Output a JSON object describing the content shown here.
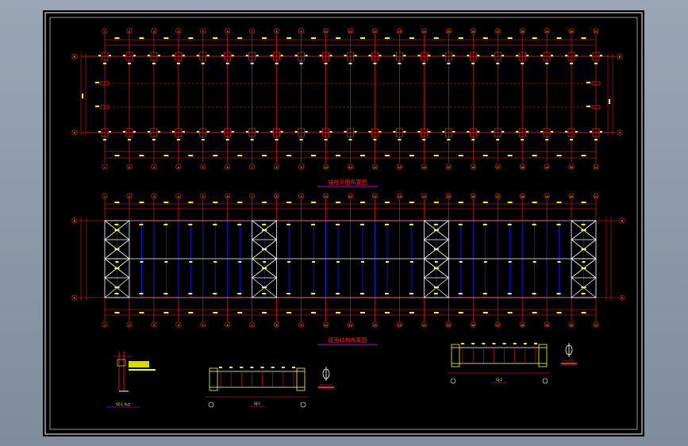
{
  "drawing": {
    "plan_title_1": "锚栓平面布置图",
    "plan_title_2": "屋面结构布置图",
    "row_top": "B",
    "row_bottom": "A",
    "axis_labels": [
      "1",
      "2",
      "3",
      "4",
      "5",
      "6",
      "7",
      "8",
      "9",
      "10",
      "11",
      "12",
      "13",
      "14",
      "15",
      "16",
      "17",
      "18",
      "19",
      "20",
      "21"
    ],
    "detail_labels": [
      "YZ-1 节点",
      "GJ-1",
      "GJ-2"
    ]
  },
  "colors": {
    "background": "#000000",
    "axis_red": "#ff2020",
    "dim_yellow": "#ffff00",
    "purlin_blue": "#1414ff",
    "frame_white": "#ffffff",
    "title_magenta": "#ff00ff"
  }
}
